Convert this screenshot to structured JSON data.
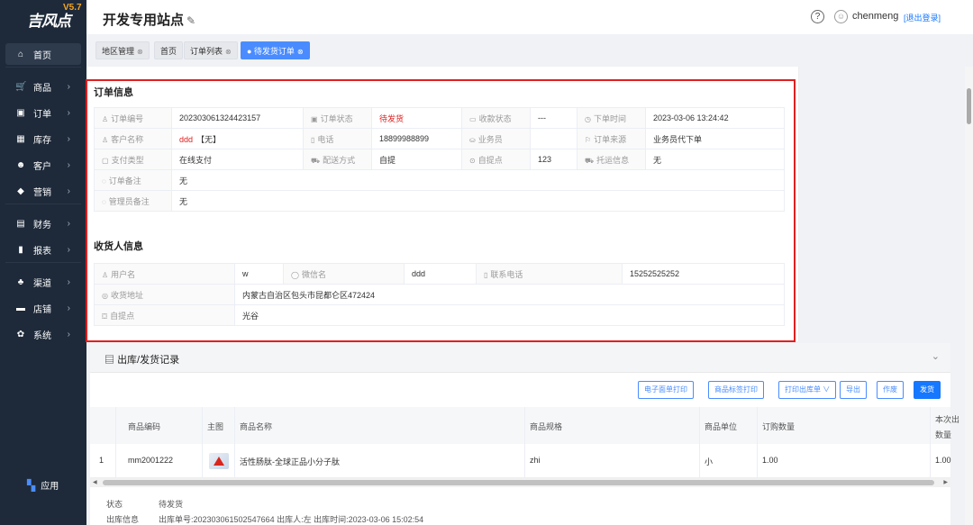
{
  "app": {
    "logo_text": "吉风点",
    "version": "V5.7"
  },
  "sidebar": {
    "items": [
      {
        "label": "首页",
        "icon": "home-icon",
        "glyph": "⌂",
        "arrow": false
      },
      {
        "label": "商品",
        "icon": "cart-icon",
        "glyph": "🛒",
        "arrow": true
      },
      {
        "label": "订单",
        "icon": "order-icon",
        "glyph": "▣",
        "arrow": true
      },
      {
        "label": "库存",
        "icon": "stock-icon",
        "glyph": "▦",
        "arrow": true
      },
      {
        "label": "客户",
        "icon": "customer-icon",
        "glyph": "☻",
        "arrow": true
      },
      {
        "label": "营销",
        "icon": "marketing-icon",
        "glyph": "◆",
        "arrow": true
      },
      {
        "label": "财务",
        "icon": "finance-icon",
        "glyph": "▤",
        "arrow": true
      },
      {
        "label": "报表",
        "icon": "report-icon",
        "glyph": "▮",
        "arrow": true
      },
      {
        "label": "渠道",
        "icon": "channel-icon",
        "glyph": "♣",
        "arrow": true
      },
      {
        "label": "店铺",
        "icon": "shop-icon",
        "glyph": "▬",
        "arrow": true
      },
      {
        "label": "系统",
        "icon": "system-icon",
        "glyph": "✿",
        "arrow": true
      }
    ],
    "apps_label": "应用"
  },
  "header": {
    "title": "开发专用站点",
    "username": "chenmeng",
    "logout": "[退出登录]"
  },
  "tabs": [
    {
      "label": "地区管理",
      "closable": true
    },
    {
      "label": "首页",
      "closable": false
    },
    {
      "label": "订单列表",
      "closable": true
    },
    {
      "label": "● 待发货订单",
      "closable": true,
      "active": true
    }
  ],
  "order": {
    "section_title": "订单信息",
    "rows": [
      [
        {
          "label": "订单编号",
          "icon": "♙",
          "value": "202303061324423157"
        },
        {
          "label": "订单状态",
          "icon": "▣",
          "value": "待发货",
          "red": true
        },
        {
          "label": "收款状态",
          "icon": "▭",
          "value": "---"
        },
        {
          "label": "下单时间",
          "icon": "◷",
          "value": "2023-03-06 13:24:42"
        }
      ],
      [
        {
          "label": "客户名称",
          "icon": "♙",
          "value": "ddd",
          "value_suffix": "【无】"
        },
        {
          "label": "电话",
          "icon": "▯",
          "value": "18899988899"
        },
        {
          "label": "业务员",
          "icon": "⛀",
          "value": ""
        },
        {
          "label": "订单来源",
          "icon": "⚐",
          "value": "业务员代下单"
        }
      ],
      [
        {
          "label": "支付类型",
          "icon": "▢",
          "value": "在线支付"
        },
        {
          "label": "配送方式",
          "icon": "⛟",
          "value": "自提"
        },
        {
          "label": "自提点",
          "icon": "⊙",
          "value": "123"
        },
        {
          "label": "托运信息",
          "icon": "⛟",
          "value": "无"
        }
      ]
    ],
    "order_note_label": "订单备注",
    "order_note_value": "无",
    "admin_note_label": "管理员备注",
    "admin_note_value": "无"
  },
  "receiver": {
    "section_title": "收货人信息",
    "username_label": "用户名",
    "username_value": "w",
    "wechat_label": "微信名",
    "wechat_value": "ddd",
    "phone_label": "联系电话",
    "phone_value": "15252525252",
    "address_label": "收货地址",
    "address_value": "内蒙古自治区包头市昆都仑区472424",
    "pickup_label": "自提点",
    "pickup_value": "光谷"
  },
  "shipping": {
    "title": "出库/发货记录",
    "buttons": [
      "电子面单打印",
      "商品标签打印",
      "打印出库单 ∨",
      "导出",
      "作废",
      "发货"
    ],
    "columns": [
      "商品编码",
      "主图",
      "商品名称",
      "商品规格",
      "商品单位",
      "订购数量",
      "本次出",
      "数量"
    ],
    "row": {
      "index": "1",
      "code": "mm2001222",
      "name": "活性肠肽-全球正品小分子肽",
      "spec": "zhi",
      "unit": "小",
      "qty": "1.00",
      "out_qty": "1.00"
    },
    "status_label": "状态",
    "status_value": "待发货",
    "outbound_label": "出库信息",
    "outbound_value": "出库单号:202303061502547664  出库人:左  出库时间:2023-03-06 15:02:54"
  },
  "colors": {
    "sidebar_bg": "#1e2a3a",
    "accent": "#1677ff",
    "status_red": "#e02020"
  }
}
